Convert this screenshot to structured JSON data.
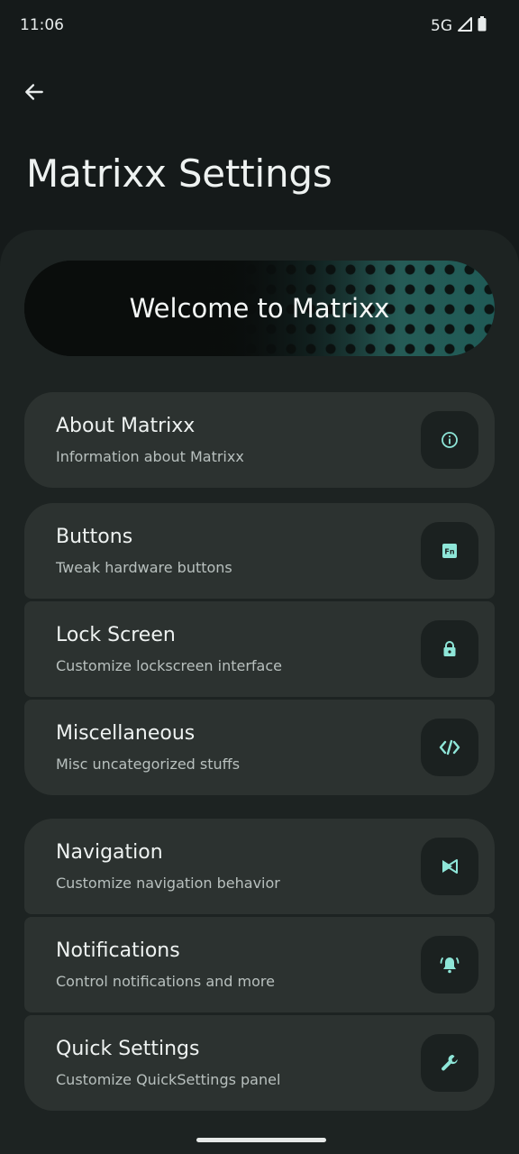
{
  "status_bar": {
    "time": "11:06",
    "network": "5G",
    "icons": [
      "signal-icon",
      "battery-icon"
    ]
  },
  "header": {
    "back_icon": "arrow-back-icon",
    "title": "Matrixx Settings"
  },
  "banner": {
    "text": "Welcome to Matrixx"
  },
  "groups": [
    {
      "items": [
        {
          "title": "About Matrixx",
          "summary": "Information about Matrixx",
          "icon": "info-icon"
        }
      ]
    },
    {
      "items": [
        {
          "title": "Buttons",
          "summary": "Tweak hardware buttons",
          "icon": "fn-key-icon"
        },
        {
          "title": "Lock Screen",
          "summary": "Customize lockscreen interface",
          "icon": "lock-icon"
        },
        {
          "title": "Miscellaneous",
          "summary": "Misc uncategorized stuffs",
          "icon": "code-icon"
        }
      ]
    },
    {
      "items": [
        {
          "title": "Navigation",
          "summary": "Customize navigation behavior",
          "icon": "navigation-icon"
        },
        {
          "title": "Notifications",
          "summary": "Control notifications and more",
          "icon": "notification-bell-icon"
        },
        {
          "title": "Quick Settings",
          "summary": "Customize QuickSettings panel",
          "icon": "wrench-icon"
        }
      ]
    }
  ],
  "colors": {
    "background": "#151a1a",
    "card": "#2c3230",
    "icon_accent": "#8ee6d8"
  }
}
